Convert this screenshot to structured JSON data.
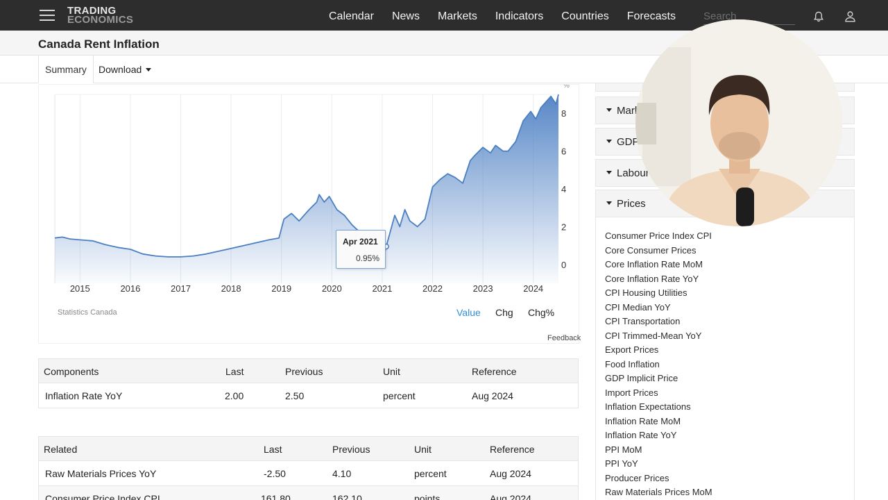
{
  "nav": {
    "logo_line1": "TRADING",
    "logo_line2": "ECONOMICS",
    "items": [
      "Calendar",
      "News",
      "Markets",
      "Indicators",
      "Countries",
      "Forecasts"
    ],
    "search_placeholder": "Search"
  },
  "page": {
    "title": "Canada Rent Inflation"
  },
  "tabs": {
    "summary": "Summary",
    "download": "Download"
  },
  "chart": {
    "source": "Statistics Canada",
    "modes": [
      "Value",
      "Chg",
      "Chg%"
    ],
    "active_mode": "Value",
    "feedback": "Feedback",
    "unit_symbol": "%",
    "tooltip": {
      "date": "Apr 2021",
      "value": "0.95%"
    }
  },
  "chart_data": {
    "type": "area",
    "xlabel": "",
    "ylabel": "",
    "ylim": [
      -1,
      9
    ],
    "xlim": [
      2014.5,
      2024.5
    ],
    "x_ticks": [
      "2015",
      "2016",
      "2017",
      "2018",
      "2019",
      "2020",
      "2021",
      "2022",
      "2023",
      "2024"
    ],
    "y_ticks": [
      "0",
      "2",
      "4",
      "6",
      "8"
    ],
    "series": [
      {
        "x": [
          2014.5,
          2014.65,
          2014.8,
          2015.0,
          2015.25,
          2015.5,
          2015.75,
          2016.0,
          2016.25,
          2016.5,
          2016.75,
          2017.0,
          2017.25,
          2017.5,
          2017.75,
          2018.0,
          2018.25,
          2018.5,
          2018.75,
          2018.95,
          2019.05,
          2019.2,
          2019.35,
          2019.55,
          2019.7,
          2019.75,
          2019.85,
          2019.95,
          2020.1,
          2020.25,
          2020.4,
          2020.6,
          2020.8,
          2021.0,
          2021.08,
          2021.25,
          2021.35,
          2021.45,
          2021.55,
          2021.7,
          2021.85,
          2022.0,
          2022.15,
          2022.3,
          2022.45,
          2022.6,
          2022.75,
          2022.85,
          2023.0,
          2023.15,
          2023.25,
          2023.4,
          2023.5,
          2023.65,
          2023.8,
          2023.95,
          2024.05,
          2024.15,
          2024.25,
          2024.35,
          2024.45,
          2024.5
        ],
        "y": [
          1.4,
          1.45,
          1.35,
          1.3,
          1.25,
          1.05,
          0.9,
          0.8,
          0.55,
          0.45,
          0.4,
          0.4,
          0.45,
          0.55,
          0.7,
          0.85,
          1.0,
          1.15,
          1.3,
          1.4,
          2.4,
          2.7,
          2.3,
          2.9,
          3.3,
          3.7,
          3.3,
          3.6,
          2.9,
          2.6,
          2.1,
          1.6,
          1.3,
          0.0,
          0.95,
          2.6,
          2.0,
          2.9,
          2.3,
          2.0,
          2.4,
          4.1,
          4.5,
          4.8,
          4.6,
          4.3,
          5.5,
          5.8,
          6.2,
          5.9,
          6.3,
          6.0,
          6.0,
          6.5,
          7.6,
          8.1,
          7.7,
          8.3,
          8.6,
          8.9,
          8.5,
          9.0
        ]
      }
    ]
  },
  "components": {
    "headers": [
      "Components",
      "Last",
      "Previous",
      "Unit",
      "Reference"
    ],
    "rows": [
      [
        "Inflation Rate YoY",
        "2.00",
        "2.50",
        "percent",
        "Aug 2024"
      ]
    ]
  },
  "related": {
    "headers": [
      "Related",
      "Last",
      "Previous",
      "Unit",
      "Reference"
    ],
    "rows": [
      [
        "Raw Materials Prices YoY",
        "-2.50",
        "4.10",
        "percent",
        "Aug 2024"
      ],
      [
        "Consumer Price Index CPI",
        "161.80",
        "162.10",
        "points",
        "Aug 2024"
      ]
    ]
  },
  "sidebar": {
    "sections": [
      "Markets",
      "GDP",
      "Labour",
      "Prices"
    ],
    "prices_links": [
      "Consumer Price Index CPI",
      "Core Consumer Prices",
      "Core Inflation Rate MoM",
      "Core Inflation Rate YoY",
      "CPI Housing Utilities",
      "CPI Median YoY",
      "CPI Transportation",
      "CPI Trimmed-Mean YoY",
      "Export Prices",
      "Food Inflation",
      "GDP Implicit Price",
      "Import Prices",
      "Inflation Expectations",
      "Inflation Rate MoM",
      "Inflation Rate YoY",
      "PPI MoM",
      "PPI YoY",
      "Producer Prices",
      "Raw Materials Prices MoM"
    ]
  },
  "colors": {
    "nav_bg": "#2d2d2d",
    "line": "#4a7fc1",
    "area_top": "#4f81c4",
    "active_mode": "#2e8fd6"
  }
}
